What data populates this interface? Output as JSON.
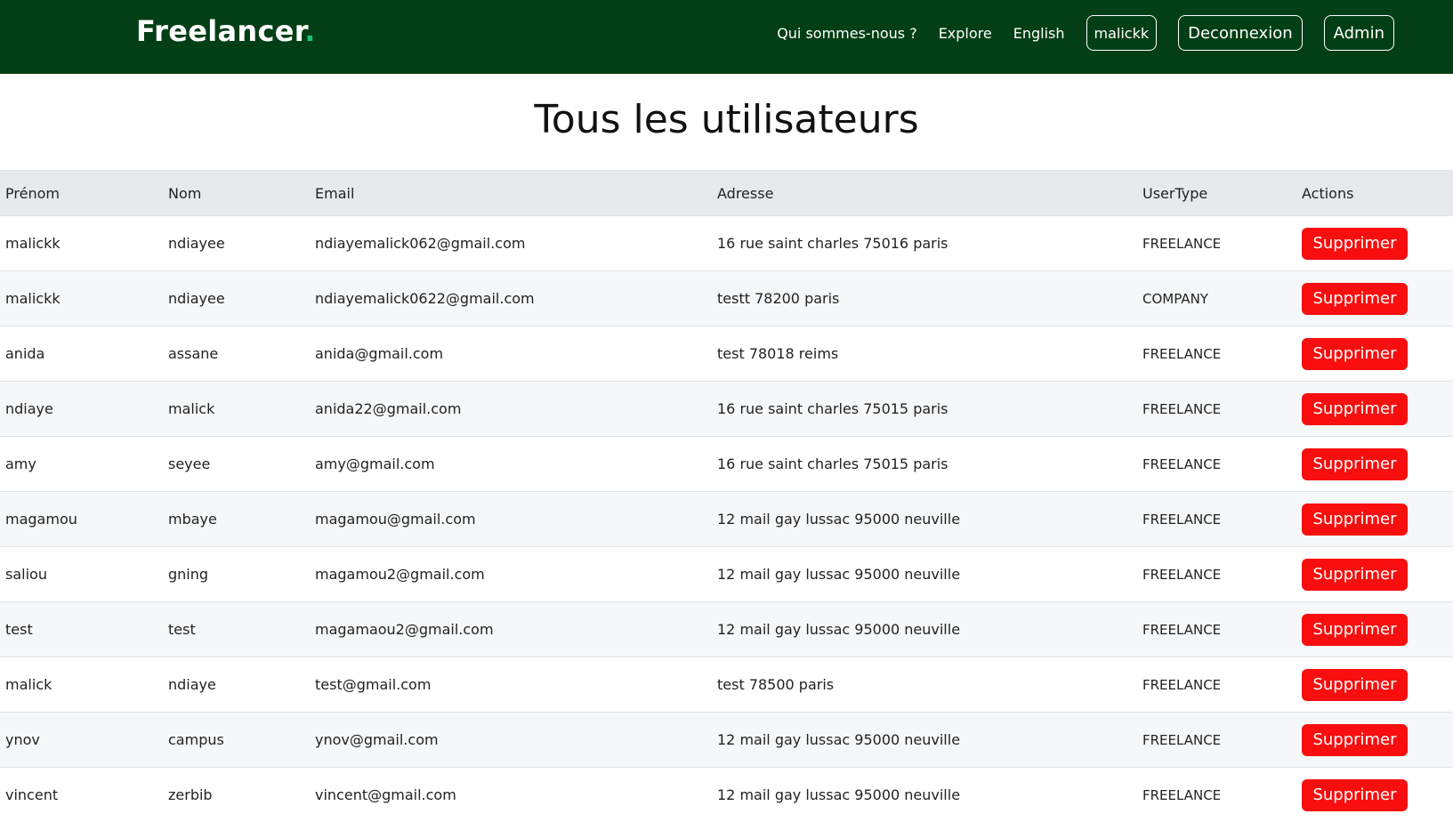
{
  "brand": {
    "name": "Freelancer",
    "dot": "."
  },
  "nav": {
    "about": "Qui sommes-nous ?",
    "explore": "Explore",
    "language": "English",
    "user": "malickk",
    "logout": "Deconnexion",
    "admin": "Admin"
  },
  "page": {
    "title": "Tous les utilisateurs"
  },
  "table": {
    "headers": {
      "firstname": "Prénom",
      "lastname": "Nom",
      "email": "Email",
      "address": "Adresse",
      "usertype": "UserType",
      "actions": "Actions"
    },
    "delete_label": "Supprimer",
    "rows": [
      {
        "firstname": "malickk",
        "lastname": "ndiayee",
        "email": "ndiayemalick062@gmail.com",
        "address": "16 rue saint charles 75016 paris",
        "usertype": "FREELANCE"
      },
      {
        "firstname": "malickk",
        "lastname": "ndiayee",
        "email": "ndiayemalick0622@gmail.com",
        "address": "testt 78200 paris",
        "usertype": "COMPANY"
      },
      {
        "firstname": "anida",
        "lastname": "assane",
        "email": "anida@gmail.com",
        "address": "test 78018 reims",
        "usertype": "FREELANCE"
      },
      {
        "firstname": "ndiaye",
        "lastname": "malick",
        "email": "anida22@gmail.com",
        "address": "16 rue saint charles 75015 paris",
        "usertype": "FREELANCE"
      },
      {
        "firstname": "amy",
        "lastname": "seyee",
        "email": "amy@gmail.com",
        "address": "16 rue saint charles 75015 paris",
        "usertype": "FREELANCE"
      },
      {
        "firstname": "magamou",
        "lastname": "mbaye",
        "email": "magamou@gmail.com",
        "address": "12 mail gay lussac 95000 neuville",
        "usertype": "FREELANCE"
      },
      {
        "firstname": "saliou",
        "lastname": "gning",
        "email": "magamou2@gmail.com",
        "address": "12 mail gay lussac 95000 neuville",
        "usertype": "FREELANCE"
      },
      {
        "firstname": "test",
        "lastname": "test",
        "email": "magamaou2@gmail.com",
        "address": "12 mail gay lussac 95000 neuville",
        "usertype": "FREELANCE"
      },
      {
        "firstname": "malick",
        "lastname": "ndiaye",
        "email": "test@gmail.com",
        "address": "test 78500 paris",
        "usertype": "FREELANCE"
      },
      {
        "firstname": "ynov",
        "lastname": "campus",
        "email": "ynov@gmail.com",
        "address": "12 mail gay lussac 95000 neuville",
        "usertype": "FREELANCE"
      },
      {
        "firstname": "vincent",
        "lastname": "zerbib",
        "email": "vincent@gmail.com",
        "address": "12 mail gay lussac 95000 neuville",
        "usertype": "FREELANCE"
      }
    ]
  },
  "colors": {
    "navbar_bg": "#033f16",
    "brand_dot": "#19c27a",
    "delete_button": "#f80e0e",
    "header_row_bg": "#e7eaed"
  }
}
